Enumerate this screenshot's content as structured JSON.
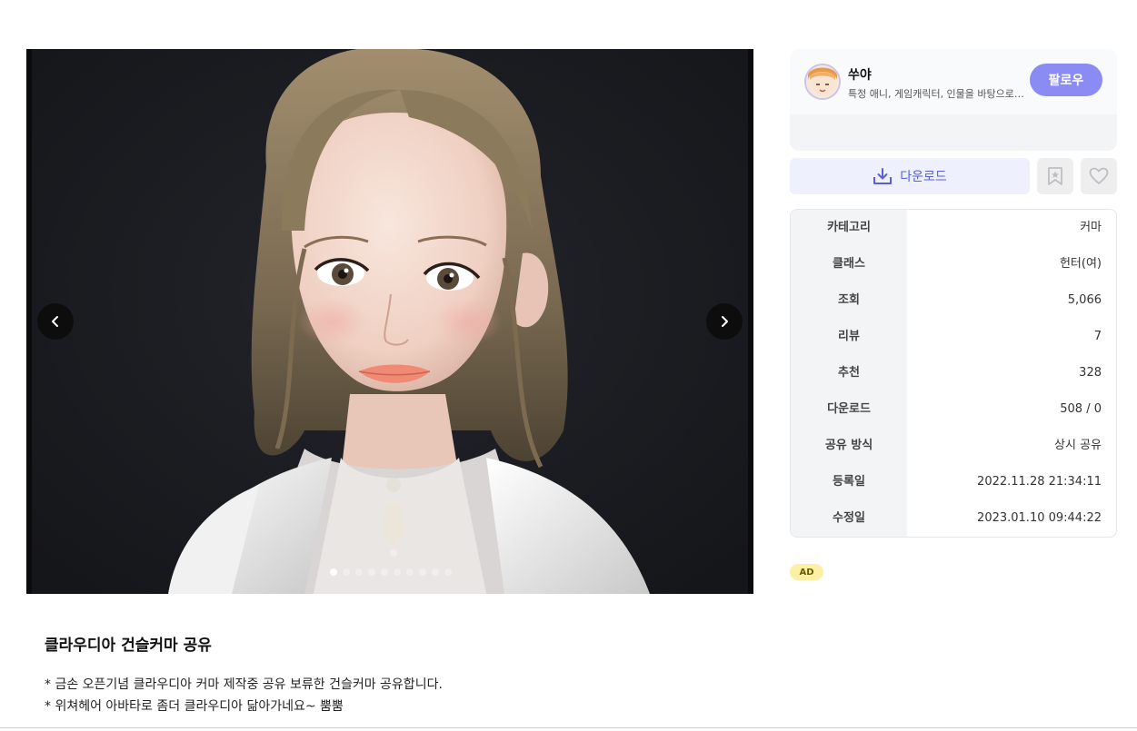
{
  "viewer": {
    "image_alt": "character",
    "slide_count": 10,
    "active_slide": 1,
    "prev_icon": "chevron-left-icon",
    "next_icon": "chevron-right-icon"
  },
  "post": {
    "title": "클라우디아 건슬커마 공유",
    "body_lines": [
      "* 금손 오픈기념 클라우디아 커마 제작중 공유 보류한 건슬커마 공유합니다.",
      "* 위쳐헤어 아바타로 좀더 클라우디아 닮아가네요~ 뿜뿜"
    ]
  },
  "author": {
    "name": "쑤야",
    "description": "특정 애니, 게임캐릭터, 인물을 바탕으로 커마를 만듭니다",
    "follow_label": "팔로우",
    "accent_color": "#8a8cf4"
  },
  "actions": {
    "download_label": "다운로드",
    "download_icon": "download-icon",
    "bookmark_icon": "bookmark-icon",
    "like_icon": "heart-icon"
  },
  "info": [
    {
      "label": "카테고리",
      "value": "커마"
    },
    {
      "label": "클래스",
      "value": "헌터(여)"
    },
    {
      "label": "조회",
      "value": "5,066"
    },
    {
      "label": "리뷰",
      "value": "7"
    },
    {
      "label": "추천",
      "value": "328"
    },
    {
      "label": "다운로드",
      "value": "508 / 0"
    },
    {
      "label": "공유 방식",
      "value": "상시 공유"
    },
    {
      "label": "등록일",
      "value": "2022.11.28 21:34:11"
    },
    {
      "label": "수정일",
      "value": "2023.01.10 09:44:22"
    }
  ],
  "ad_label": "AD"
}
